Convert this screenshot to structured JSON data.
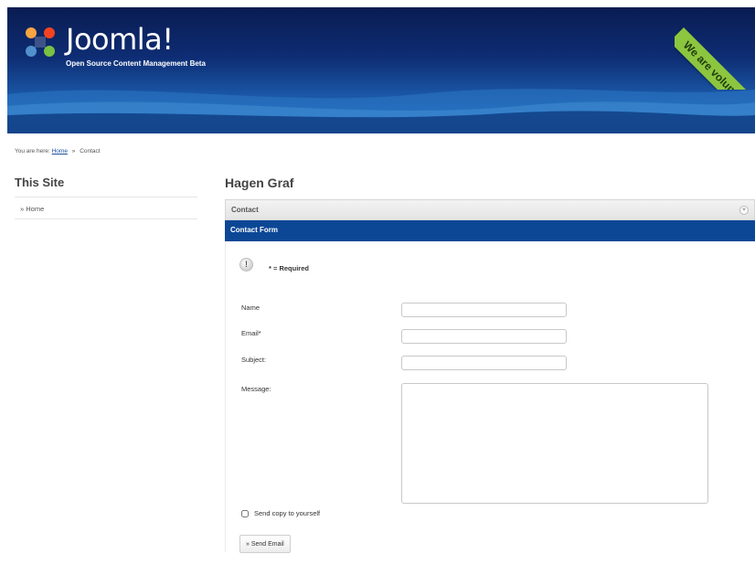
{
  "header": {
    "logo_text": "Joomla!",
    "tagline": "Open Source Content Management Beta",
    "ribbon_text": "We are volunteers",
    "colors": {
      "banner_dark": "#0a1c52",
      "banner_light": "#1f68b8",
      "ribbon": "#8cc63f"
    }
  },
  "breadcrumb": {
    "prefix": "You are here:",
    "home": "Home",
    "separator": "»",
    "current": "Contact"
  },
  "sidebar": {
    "title": "This Site",
    "items": [
      {
        "label": "» Home"
      }
    ]
  },
  "main": {
    "title": "Hagen Graf",
    "contact_bar": "Contact",
    "form_bar": "Contact Form",
    "required_note": "* = Required",
    "fields": {
      "name_label": "Name",
      "email_label": "Email*",
      "subject_label": "Subject:",
      "message_label": "Message:",
      "name_value": "",
      "email_value": "",
      "subject_value": "",
      "message_value": ""
    },
    "copy_label": "Send copy to yourself",
    "send_button": "» Send Email",
    "accent_color": "#0c4796"
  }
}
